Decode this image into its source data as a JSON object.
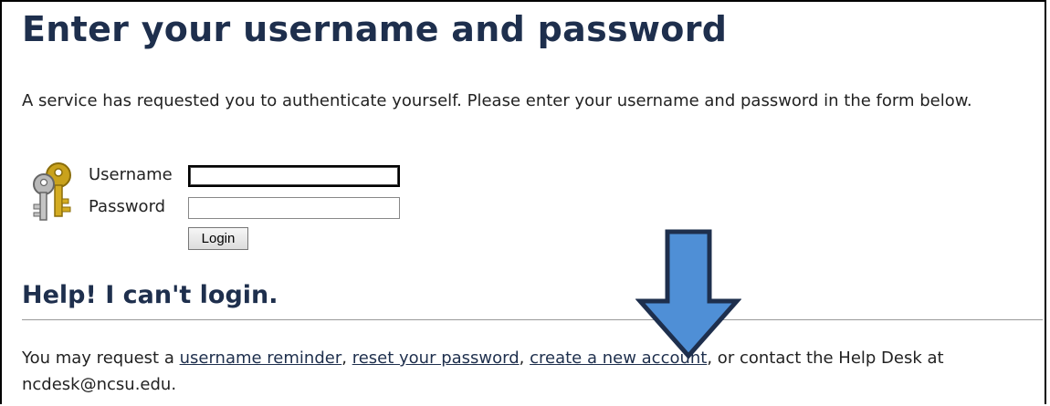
{
  "header": {
    "title": "Enter your username and password"
  },
  "intro": {
    "text": "A service has requested you to authenticate yourself. Please enter your username and password in the form below."
  },
  "login_form": {
    "icon": "keys-icon",
    "username_label": "Username",
    "username_value": "",
    "password_label": "Password",
    "password_value": "",
    "login_button": "Login"
  },
  "help": {
    "title": "Help! I can't login.",
    "text_before": "You may request a ",
    "link_username_reminder": "username reminder",
    "sep1": ", ",
    "link_reset_password": "reset your password",
    "sep2": ", ",
    "link_create_account": "create a new account",
    "text_after": ", or contact the Help Desk at ncdesk@ncsu.edu."
  },
  "annotation": {
    "icon": "arrow-down-icon",
    "fill_color": "#4f8fd6",
    "stroke_color": "#1e2f4d"
  },
  "colors": {
    "heading": "#1e2f4d",
    "text": "#222222"
  }
}
